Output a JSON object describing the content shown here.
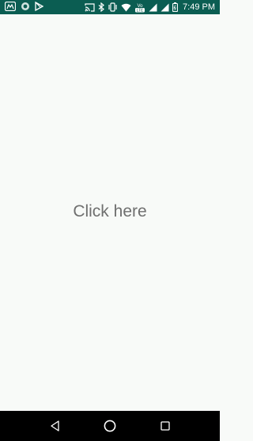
{
  "status_bar": {
    "time": "7:49 PM",
    "notification_icons": [
      "app-m-icon",
      "circle-app-icon",
      "play-store-icon"
    ],
    "system_icons": [
      "cast-icon",
      "bluetooth-icon",
      "vibrate-icon",
      "wifi-icon",
      "volte-icon",
      "signal-icon",
      "signal-icon",
      "battery-icon"
    ],
    "background_color": "#0b5d52"
  },
  "main": {
    "center_text": "Click here",
    "text_color": "#6f6f6f",
    "background_color": "#f8faf8"
  },
  "nav_bar": {
    "buttons": [
      "back-icon",
      "home-icon",
      "recent-apps-icon"
    ],
    "background_color": "#000000"
  }
}
